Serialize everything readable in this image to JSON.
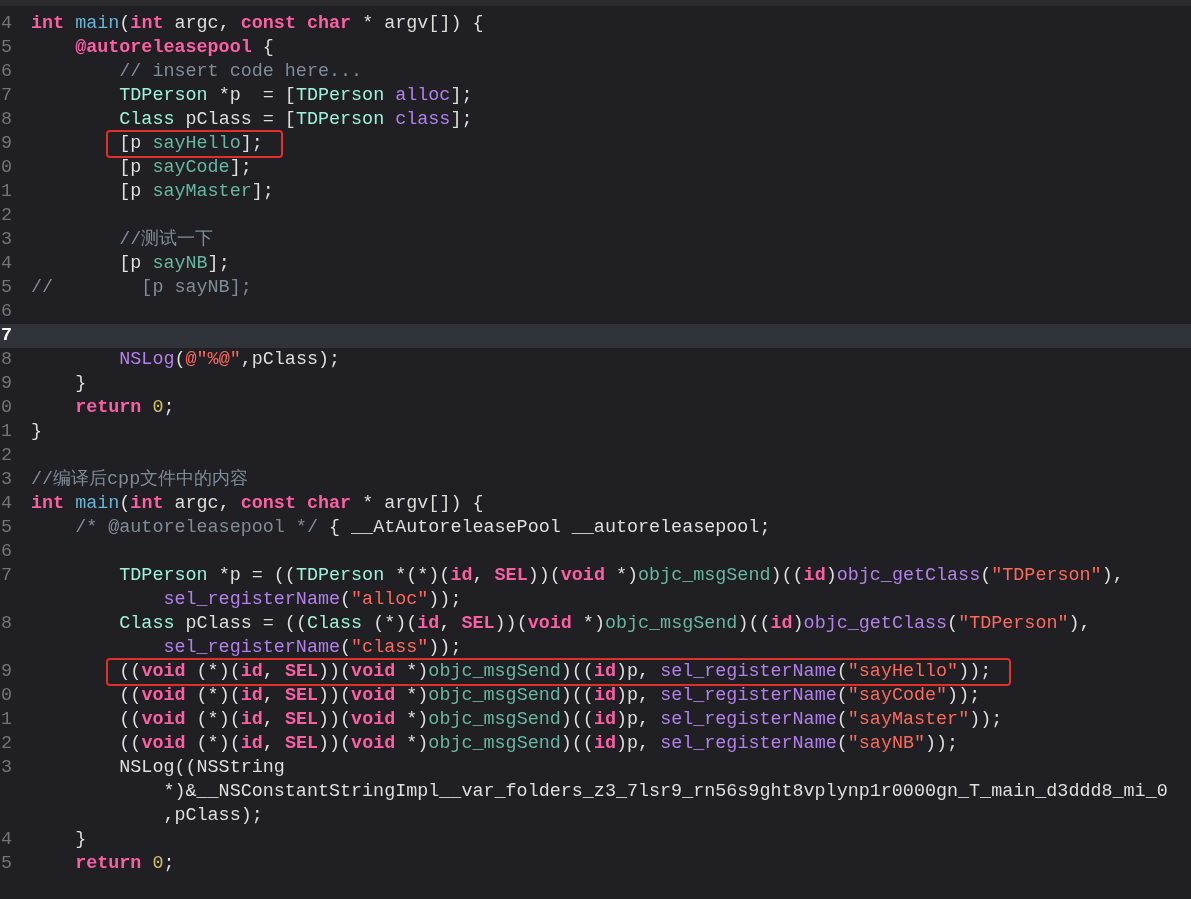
{
  "editor": {
    "rows": [
      {
        "number": "4",
        "current": false,
        "boxed": false,
        "segments": [
          {
            "kind": "keyword",
            "text": "int "
          },
          {
            "kind": "function",
            "text": "main"
          },
          {
            "kind": "plain",
            "text": "("
          },
          {
            "kind": "keyword",
            "text": "int"
          },
          {
            "kind": "plain",
            "text": " argc, "
          },
          {
            "kind": "keyword",
            "text": "const char"
          },
          {
            "kind": "plain",
            "text": " * argv[]) {"
          }
        ]
      },
      {
        "number": "5",
        "current": false,
        "boxed": false,
        "segments": [
          {
            "kind": "keyword",
            "text": "    @autoreleasepool"
          },
          {
            "kind": "plain",
            "text": " {"
          }
        ]
      },
      {
        "number": "6",
        "current": false,
        "boxed": false,
        "segments": [
          {
            "kind": "comment",
            "text": "        // insert code here..."
          }
        ]
      },
      {
        "number": "7",
        "current": false,
        "boxed": false,
        "segments": [
          {
            "kind": "type",
            "text": "        TDPerson"
          },
          {
            "kind": "plain",
            "text": " *p  = ["
          },
          {
            "kind": "type",
            "text": "TDPerson "
          },
          {
            "kind": "library",
            "text": "alloc"
          },
          {
            "kind": "plain",
            "text": "];"
          }
        ]
      },
      {
        "number": "8",
        "current": false,
        "boxed": false,
        "segments": [
          {
            "kind": "type",
            "text": "        Class"
          },
          {
            "kind": "plain",
            "text": " pClass = ["
          },
          {
            "kind": "type",
            "text": "TDPerson "
          },
          {
            "kind": "library",
            "text": "class"
          },
          {
            "kind": "plain",
            "text": "];"
          }
        ]
      },
      {
        "number": "9",
        "current": false,
        "boxed": true,
        "segments": [
          {
            "kind": "plain",
            "text": "        [p "
          },
          {
            "kind": "method",
            "text": "sayHello"
          },
          {
            "kind": "plain",
            "text": "];"
          }
        ]
      },
      {
        "number": "0",
        "current": false,
        "boxed": false,
        "segments": [
          {
            "kind": "plain",
            "text": "        [p "
          },
          {
            "kind": "method",
            "text": "sayCode"
          },
          {
            "kind": "plain",
            "text": "];"
          }
        ]
      },
      {
        "number": "1",
        "current": false,
        "boxed": false,
        "segments": [
          {
            "kind": "plain",
            "text": "        [p "
          },
          {
            "kind": "method",
            "text": "sayMaster"
          },
          {
            "kind": "plain",
            "text": "];"
          }
        ]
      },
      {
        "number": "2",
        "current": false,
        "boxed": false,
        "segments": []
      },
      {
        "number": "3",
        "current": false,
        "boxed": false,
        "segments": [
          {
            "kind": "comment",
            "text": "        //测试一下"
          }
        ]
      },
      {
        "number": "4",
        "current": false,
        "boxed": false,
        "segments": [
          {
            "kind": "plain",
            "text": "        [p "
          },
          {
            "kind": "method",
            "text": "sayNB"
          },
          {
            "kind": "plain",
            "text": "];"
          }
        ]
      },
      {
        "number": "5",
        "current": false,
        "boxed": false,
        "segments": [
          {
            "kind": "comment",
            "text": "//        [p sayNB];"
          }
        ]
      },
      {
        "number": "6",
        "current": false,
        "boxed": false,
        "segments": []
      },
      {
        "number": "7",
        "current": true,
        "boxed": false,
        "segments": []
      },
      {
        "number": "8",
        "current": false,
        "boxed": false,
        "segments": [
          {
            "kind": "library",
            "text": "        NSLog"
          },
          {
            "kind": "plain",
            "text": "("
          },
          {
            "kind": "string",
            "text": "@\"%@\""
          },
          {
            "kind": "plain",
            "text": ",pClass);"
          }
        ]
      },
      {
        "number": "9",
        "current": false,
        "boxed": false,
        "segments": [
          {
            "kind": "plain",
            "text": "    }"
          }
        ]
      },
      {
        "number": "0",
        "current": false,
        "boxed": false,
        "segments": [
          {
            "kind": "keyword",
            "text": "    return "
          },
          {
            "kind": "number",
            "text": "0"
          },
          {
            "kind": "plain",
            "text": ";"
          }
        ]
      },
      {
        "number": "1",
        "current": false,
        "boxed": false,
        "segments": [
          {
            "kind": "plain",
            "text": "}"
          }
        ]
      },
      {
        "number": "2",
        "current": false,
        "boxed": false,
        "segments": []
      },
      {
        "number": "3",
        "current": false,
        "boxed": false,
        "segments": [
          {
            "kind": "comment",
            "text": "//编译后cpp文件中的内容"
          }
        ]
      },
      {
        "number": "4",
        "current": false,
        "boxed": false,
        "segments": [
          {
            "kind": "keyword",
            "text": "int "
          },
          {
            "kind": "function",
            "text": "main"
          },
          {
            "kind": "plain",
            "text": "("
          },
          {
            "kind": "keyword",
            "text": "int"
          },
          {
            "kind": "plain",
            "text": " argc, "
          },
          {
            "kind": "keyword",
            "text": "const char"
          },
          {
            "kind": "plain",
            "text": " * argv[]) {"
          }
        ]
      },
      {
        "number": "5",
        "current": false,
        "boxed": false,
        "segments": [
          {
            "kind": "comment",
            "text": "    /* @autoreleasepool */"
          },
          {
            "kind": "plain",
            "text": " { __AtAutoreleasePool __autoreleasepool;"
          }
        ]
      },
      {
        "number": "6",
        "current": false,
        "boxed": false,
        "segments": []
      },
      {
        "number": "7",
        "current": false,
        "boxed": false,
        "segments": [
          {
            "kind": "type",
            "text": "        TDPerson"
          },
          {
            "kind": "plain",
            "text": " *p = (("
          },
          {
            "kind": "type",
            "text": "TDPerson"
          },
          {
            "kind": "plain",
            "text": " *(*)("
          },
          {
            "kind": "keyword",
            "text": "id"
          },
          {
            "kind": "plain",
            "text": ", "
          },
          {
            "kind": "keyword",
            "text": "SEL"
          },
          {
            "kind": "plain",
            "text": "))("
          },
          {
            "kind": "keyword",
            "text": "void"
          },
          {
            "kind": "plain",
            "text": " *)"
          },
          {
            "kind": "method",
            "text": "objc_msgSend"
          },
          {
            "kind": "plain",
            "text": ")(("
          },
          {
            "kind": "keyword",
            "text": "id"
          },
          {
            "kind": "plain",
            "text": ")"
          },
          {
            "kind": "library",
            "text": "objc_getClass"
          },
          {
            "kind": "plain",
            "text": "("
          },
          {
            "kind": "string",
            "text": "\"TDPerson\""
          },
          {
            "kind": "plain",
            "text": "),"
          }
        ]
      },
      {
        "current": false,
        "boxed": false,
        "segments": [
          {
            "kind": "library",
            "text": "            sel_registerName"
          },
          {
            "kind": "plain",
            "text": "("
          },
          {
            "kind": "string",
            "text": "\"alloc\""
          },
          {
            "kind": "plain",
            "text": "));"
          }
        ]
      },
      {
        "number": "8",
        "current": false,
        "boxed": false,
        "segments": [
          {
            "kind": "type",
            "text": "        Class"
          },
          {
            "kind": "plain",
            "text": " pClass = (("
          },
          {
            "kind": "type",
            "text": "Class"
          },
          {
            "kind": "plain",
            "text": " (*)("
          },
          {
            "kind": "keyword",
            "text": "id"
          },
          {
            "kind": "plain",
            "text": ", "
          },
          {
            "kind": "keyword",
            "text": "SEL"
          },
          {
            "kind": "plain",
            "text": "))("
          },
          {
            "kind": "keyword",
            "text": "void"
          },
          {
            "kind": "plain",
            "text": " *)"
          },
          {
            "kind": "method",
            "text": "objc_msgSend"
          },
          {
            "kind": "plain",
            "text": ")(("
          },
          {
            "kind": "keyword",
            "text": "id"
          },
          {
            "kind": "plain",
            "text": ")"
          },
          {
            "kind": "library",
            "text": "objc_getClass"
          },
          {
            "kind": "plain",
            "text": "("
          },
          {
            "kind": "string",
            "text": "\"TDPerson\""
          },
          {
            "kind": "plain",
            "text": "),"
          }
        ]
      },
      {
        "current": false,
        "boxed": false,
        "segments": [
          {
            "kind": "library",
            "text": "            sel_registerName"
          },
          {
            "kind": "plain",
            "text": "("
          },
          {
            "kind": "string",
            "text": "\"class\""
          },
          {
            "kind": "plain",
            "text": "));"
          }
        ]
      },
      {
        "number": "9",
        "current": false,
        "boxed": true,
        "segments": [
          {
            "kind": "plain",
            "text": "        (("
          },
          {
            "kind": "keyword",
            "text": "void"
          },
          {
            "kind": "plain",
            "text": " (*)("
          },
          {
            "kind": "keyword",
            "text": "id"
          },
          {
            "kind": "plain",
            "text": ", "
          },
          {
            "kind": "keyword",
            "text": "SEL"
          },
          {
            "kind": "plain",
            "text": "))("
          },
          {
            "kind": "keyword",
            "text": "void"
          },
          {
            "kind": "plain",
            "text": " *)"
          },
          {
            "kind": "method",
            "text": "objc_msgSend"
          },
          {
            "kind": "plain",
            "text": ")(("
          },
          {
            "kind": "keyword",
            "text": "id"
          },
          {
            "kind": "plain",
            "text": ")p, "
          },
          {
            "kind": "library",
            "text": "sel_registerName"
          },
          {
            "kind": "plain",
            "text": "("
          },
          {
            "kind": "string",
            "text": "\"sayHello\""
          },
          {
            "kind": "plain",
            "text": "));"
          }
        ]
      },
      {
        "number": "0",
        "current": false,
        "boxed": false,
        "segments": [
          {
            "kind": "plain",
            "text": "        (("
          },
          {
            "kind": "keyword",
            "text": "void"
          },
          {
            "kind": "plain",
            "text": " (*)("
          },
          {
            "kind": "keyword",
            "text": "id"
          },
          {
            "kind": "plain",
            "text": ", "
          },
          {
            "kind": "keyword",
            "text": "SEL"
          },
          {
            "kind": "plain",
            "text": "))("
          },
          {
            "kind": "keyword",
            "text": "void"
          },
          {
            "kind": "plain",
            "text": " *)"
          },
          {
            "kind": "method",
            "text": "objc_msgSend"
          },
          {
            "kind": "plain",
            "text": ")(("
          },
          {
            "kind": "keyword",
            "text": "id"
          },
          {
            "kind": "plain",
            "text": ")p, "
          },
          {
            "kind": "library",
            "text": "sel_registerName"
          },
          {
            "kind": "plain",
            "text": "("
          },
          {
            "kind": "string",
            "text": "\"sayCode\""
          },
          {
            "kind": "plain",
            "text": "));"
          }
        ]
      },
      {
        "number": "1",
        "current": false,
        "boxed": false,
        "segments": [
          {
            "kind": "plain",
            "text": "        (("
          },
          {
            "kind": "keyword",
            "text": "void"
          },
          {
            "kind": "plain",
            "text": " (*)("
          },
          {
            "kind": "keyword",
            "text": "id"
          },
          {
            "kind": "plain",
            "text": ", "
          },
          {
            "kind": "keyword",
            "text": "SEL"
          },
          {
            "kind": "plain",
            "text": "))("
          },
          {
            "kind": "keyword",
            "text": "void"
          },
          {
            "kind": "plain",
            "text": " *)"
          },
          {
            "kind": "method",
            "text": "objc_msgSend"
          },
          {
            "kind": "plain",
            "text": ")(("
          },
          {
            "kind": "keyword",
            "text": "id"
          },
          {
            "kind": "plain",
            "text": ")p, "
          },
          {
            "kind": "library",
            "text": "sel_registerName"
          },
          {
            "kind": "plain",
            "text": "("
          },
          {
            "kind": "string",
            "text": "\"sayMaster\""
          },
          {
            "kind": "plain",
            "text": "));"
          }
        ]
      },
      {
        "number": "2",
        "current": false,
        "boxed": false,
        "segments": [
          {
            "kind": "plain",
            "text": "        (("
          },
          {
            "kind": "keyword",
            "text": "void"
          },
          {
            "kind": "plain",
            "text": " (*)("
          },
          {
            "kind": "keyword",
            "text": "id"
          },
          {
            "kind": "plain",
            "text": ", "
          },
          {
            "kind": "keyword",
            "text": "SEL"
          },
          {
            "kind": "plain",
            "text": "))("
          },
          {
            "kind": "keyword",
            "text": "void"
          },
          {
            "kind": "plain",
            "text": " *)"
          },
          {
            "kind": "method",
            "text": "objc_msgSend"
          },
          {
            "kind": "plain",
            "text": ")(("
          },
          {
            "kind": "keyword",
            "text": "id"
          },
          {
            "kind": "plain",
            "text": ")p, "
          },
          {
            "kind": "library",
            "text": "sel_registerName"
          },
          {
            "kind": "plain",
            "text": "("
          },
          {
            "kind": "string",
            "text": "\"sayNB\""
          },
          {
            "kind": "plain",
            "text": "));"
          }
        ]
      },
      {
        "number": "3",
        "current": false,
        "boxed": false,
        "segments": [
          {
            "kind": "plain",
            "text": "        NSLog((NSString"
          }
        ]
      },
      {
        "current": false,
        "boxed": false,
        "segments": [
          {
            "kind": "plain",
            "text": "            *)&__NSConstantStringImpl__var_folders_z3_7lsr9_rn56s9ght8vplynp1r0000gn_T_main_d3ddd8_mi_0"
          }
        ]
      },
      {
        "current": false,
        "boxed": false,
        "segments": [
          {
            "kind": "plain",
            "text": "            ,pClass);"
          }
        ]
      },
      {
        "number": "4",
        "current": false,
        "boxed": false,
        "segments": [
          {
            "kind": "plain",
            "text": "    }"
          }
        ]
      },
      {
        "number": "5",
        "current": false,
        "boxed": false,
        "segments": [
          {
            "kind": "keyword",
            "text": "    return "
          },
          {
            "kind": "number",
            "text": "0"
          },
          {
            "kind": "plain",
            "text": ";"
          }
        ]
      }
    ]
  }
}
